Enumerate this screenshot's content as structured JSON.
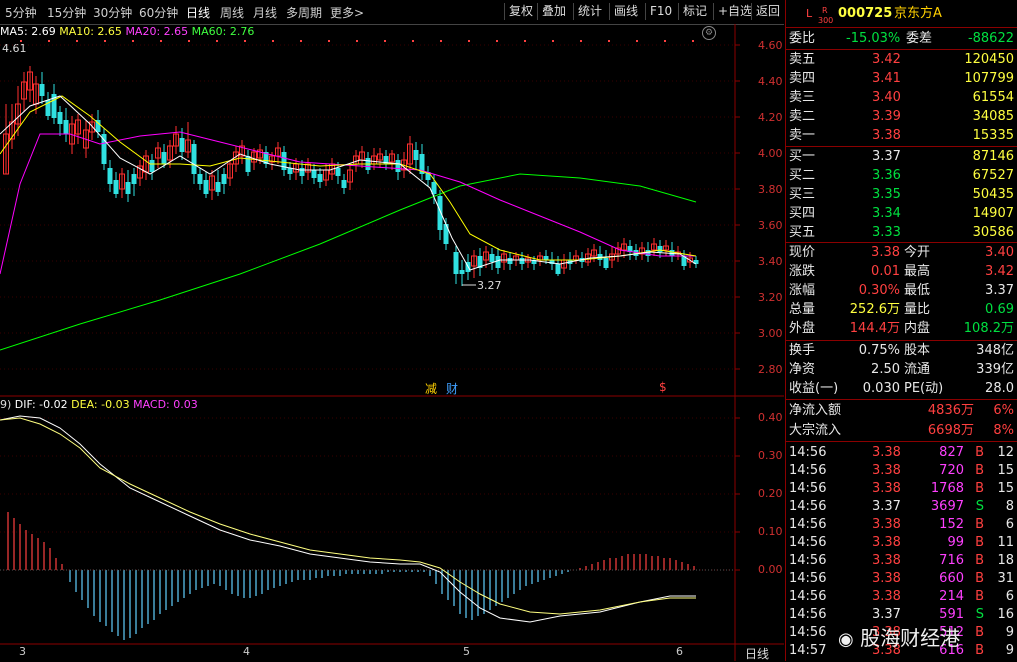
{
  "toolbar": {
    "timeframes": [
      "5分钟",
      "15分钟",
      "30分钟",
      "60分钟",
      "日线",
      "周线",
      "月线",
      "多周期",
      "更多>"
    ],
    "active_timeframe": "日线",
    "buttons": [
      "复权",
      "叠加",
      "统计",
      "画线",
      "F10",
      "标记",
      "+自选",
      "返回"
    ]
  },
  "main_chart": {
    "ma_legend": {
      "ma5": "MA5: 2.69",
      "ma10": "MA10: 2.65",
      "ma20": "MA20: 2.65",
      "ma60": "MA60: 2.76"
    },
    "high_label": "4.61",
    "low_label": "3.27",
    "price_ticks": [
      "4.60",
      "4.40",
      "4.20",
      "4.00",
      "3.80",
      "3.60",
      "3.40",
      "3.20",
      "3.00",
      "2.80"
    ],
    "markers": [
      "减",
      "财",
      "$"
    ],
    "colors": {
      "ma5": "#ffffff",
      "ma10": "#ffff00",
      "ma20": "#ff00ff",
      "ma60": "#00ff00",
      "up": "#ff3030",
      "down": "#30e0e0"
    }
  },
  "macd_chart": {
    "legend_prefix": "9)",
    "dif": "DIF: -0.02",
    "dea": "DEA: -0.03",
    "macd": "MACD: 0.03",
    "ticks": [
      "0.40",
      "0.30",
      "0.20",
      "0.10",
      "0.00"
    ]
  },
  "x_axis": {
    "labels": [
      "3",
      "4",
      "5",
      "6"
    ],
    "period": "日线"
  },
  "quote": {
    "code": "000725",
    "name": "京东方A",
    "prefix_l": "L",
    "prefix_r": "R",
    "prefix_300": "300",
    "weibi_label": "委比",
    "weibi_value": "-15.03%",
    "weicha_label": "委差",
    "weicha_value": "-88622",
    "asks": [
      {
        "label": "卖五",
        "price": "3.42",
        "vol": "120450"
      },
      {
        "label": "卖四",
        "price": "3.41",
        "vol": "107799"
      },
      {
        "label": "卖三",
        "price": "3.40",
        "vol": "61554"
      },
      {
        "label": "卖二",
        "price": "3.39",
        "vol": "34085"
      },
      {
        "label": "卖一",
        "price": "3.38",
        "vol": "15335"
      }
    ],
    "bids": [
      {
        "label": "买一",
        "price": "3.37",
        "vol": "87146"
      },
      {
        "label": "买二",
        "price": "3.36",
        "vol": "67527"
      },
      {
        "label": "买三",
        "price": "3.35",
        "vol": "50435"
      },
      {
        "label": "买四",
        "price": "3.34",
        "vol": "14907"
      },
      {
        "label": "买五",
        "price": "3.33",
        "vol": "30586"
      }
    ],
    "stats": [
      {
        "l1": "现价",
        "v1": "3.38",
        "l2": "今开",
        "v2": "3.40"
      },
      {
        "l1": "涨跌",
        "v1": "0.01",
        "l2": "最高",
        "v2": "3.42"
      },
      {
        "l1": "涨幅",
        "v1": "0.30%",
        "l2": "最低",
        "v2": "3.37"
      },
      {
        "l1": "总量",
        "v1": "252.6万",
        "l2": "量比",
        "v2": "0.69"
      },
      {
        "l1": "外盘",
        "v1": "144.4万",
        "l2": "内盘",
        "v2": "108.2万"
      }
    ],
    "stats2": [
      {
        "l1": "换手",
        "v1": "0.75%",
        "l2": "股本",
        "v2": "348亿"
      },
      {
        "l1": "净资",
        "v1": "2.50",
        "l2": "流通",
        "v2": "339亿"
      },
      {
        "l1": "收益(一)",
        "v1": "0.030",
        "l2": "PE(动)",
        "v2": "28.0"
      }
    ],
    "flows": [
      {
        "label": "净流入额",
        "value": "4836万",
        "pct": "6%"
      },
      {
        "label": "大宗流入",
        "value": "6698万",
        "pct": "8%"
      }
    ],
    "ticks": [
      {
        "t": "14:56",
        "p": "3.38",
        "v": "827",
        "s": "B",
        "n": "12"
      },
      {
        "t": "14:56",
        "p": "3.38",
        "v": "720",
        "s": "B",
        "n": "15"
      },
      {
        "t": "14:56",
        "p": "3.38",
        "v": "1768",
        "s": "B",
        "n": "15"
      },
      {
        "t": "14:56",
        "p": "3.37",
        "v": "3697",
        "s": "S",
        "n": "8"
      },
      {
        "t": "14:56",
        "p": "3.38",
        "v": "152",
        "s": "B",
        "n": "6"
      },
      {
        "t": "14:56",
        "p": "3.38",
        "v": "99",
        "s": "B",
        "n": "11"
      },
      {
        "t": "14:56",
        "p": "3.38",
        "v": "716",
        "s": "B",
        "n": "18"
      },
      {
        "t": "14:56",
        "p": "3.38",
        "v": "660",
        "s": "B",
        "n": "31"
      },
      {
        "t": "14:56",
        "p": "3.38",
        "v": "214",
        "s": "B",
        "n": "6"
      },
      {
        "t": "14:56",
        "p": "3.37",
        "v": "591",
        "s": "S",
        "n": "16"
      },
      {
        "t": "14:56",
        "p": "3.38",
        "v": "512",
        "s": "B",
        "n": "9"
      },
      {
        "t": "14:57",
        "p": "3.38",
        "v": "616",
        "s": "B",
        "n": "9"
      }
    ]
  },
  "watermark": "股海财经港"
}
